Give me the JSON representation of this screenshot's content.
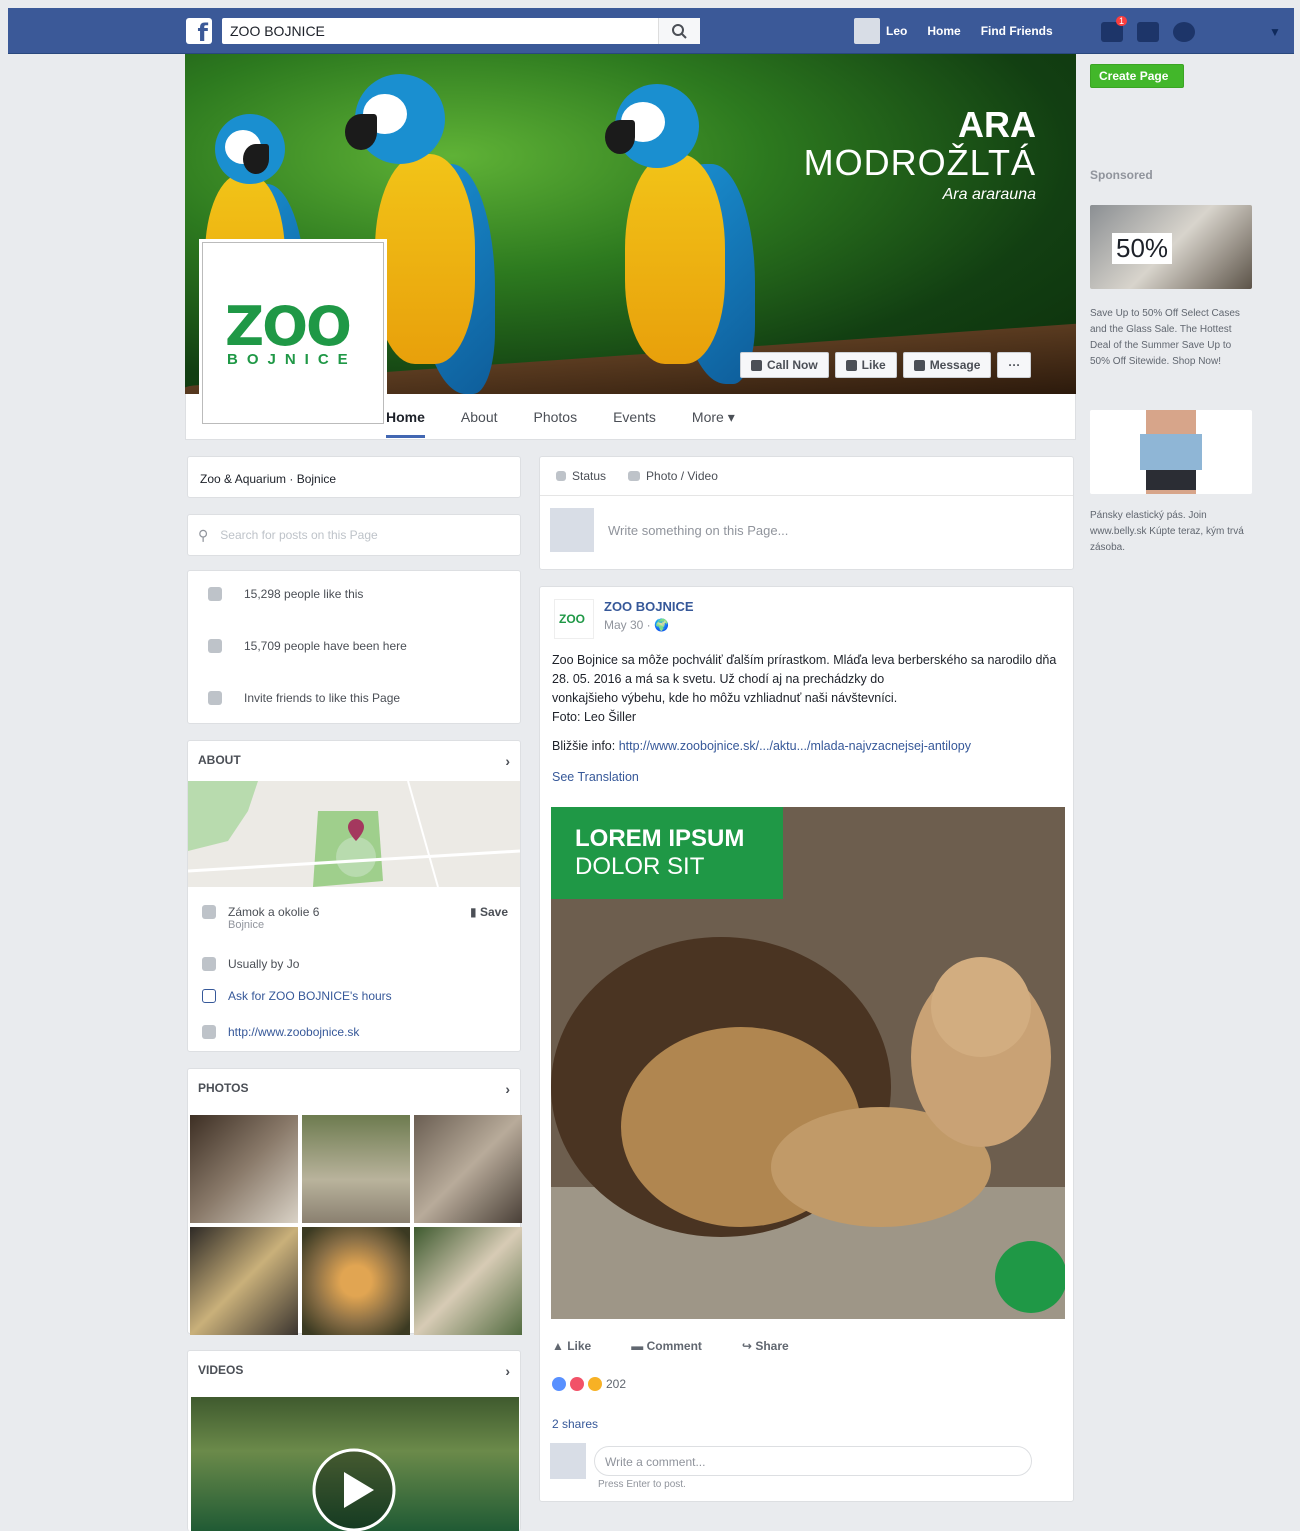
{
  "topbar": {
    "logo": "f",
    "search_value": "ZOO BOJNICE",
    "user_name": "Leo",
    "home": "Home",
    "find_friends": "Find Friends",
    "notif_count": "1"
  },
  "cover": {
    "title_line1": "ARA",
    "title_line2": "MODROŽLTÁ",
    "title_line3": "Ara ararauna",
    "buttons": {
      "call_now": "Call Now",
      "like": "Like",
      "message": "Message",
      "more": "···"
    }
  },
  "profile": {
    "logo_word": "ZOO",
    "logo_sub": "BOJNICE"
  },
  "nav": {
    "tabs": [
      "Home",
      "About",
      "Photos",
      "Events",
      "More ▾"
    ]
  },
  "left": {
    "category": "Zoo & Aquarium · Bojnice",
    "search_placeholder": "Search for posts on this Page",
    "likes": "15,298 people like this",
    "visits": "15,709 people have been here",
    "invite": "Invite friends to like this Page",
    "about_head": "ABOUT",
    "address": "Zámok a okolie 6",
    "address_city": "Bojnice",
    "save": "Save",
    "hours": "Usually by Jo",
    "ask_hours": "Ask for ZOO BOJNICE's hours",
    "website": "http://www.zoobojnice.sk",
    "photos_head": "PHOTOS",
    "videos_head": "VIDEOS"
  },
  "composer": {
    "status_tab": "Status",
    "photo_tab": "Photo / Video",
    "placeholder": "Write something on this Page..."
  },
  "post": {
    "name": "ZOO BOJNICE",
    "date": "May 30 · 🌍",
    "text_1": "Zoo Bojnice sa môže pochváliť ďalším prírastkom. Mláďa leva berberského sa narodilo dňa 28. 05. 2016 a má sa k svetu. Už chodí aj na prechádzky do",
    "text_2": "vonkajšieho výbehu, kde ho môžu vzhliadnuť naši návštevníci.",
    "text_3": "Foto: Leo Šiller",
    "more_info_label": "Bližšie info:",
    "more_info_link": "http://www.zoobojnice.sk/.../aktu.../mlada-najvzacnejsej-antilopy",
    "see_translation": "See Translation",
    "img_title_1": "LOREM IPSUM",
    "img_title_2": "DOLOR SIT",
    "like": "Like",
    "comment": "Comment",
    "share": "Share",
    "reaction_count": "202",
    "shares": "2 shares",
    "comment_placeholder": "Write a comment...",
    "press_enter": "Press Enter to post."
  },
  "right": {
    "create_page": "Create Page",
    "sponsored": "Sponsored",
    "ad1_badge": "50%",
    "ad1_text": "Save Up to 50% Off Select Cases and the Glass Sale. The Hottest Deal of the Summer Save Up to 50% Off Sitewide. Shop Now!",
    "ad2_text": "Pánsky elastický pás. Join www.belly.sk Kúpte teraz, kým trvá zásoba."
  },
  "colors": {
    "fb_blue": "#3b5998",
    "zoo_green": "#1f9846",
    "link_blue": "#365899",
    "create_green": "#42b72a"
  }
}
